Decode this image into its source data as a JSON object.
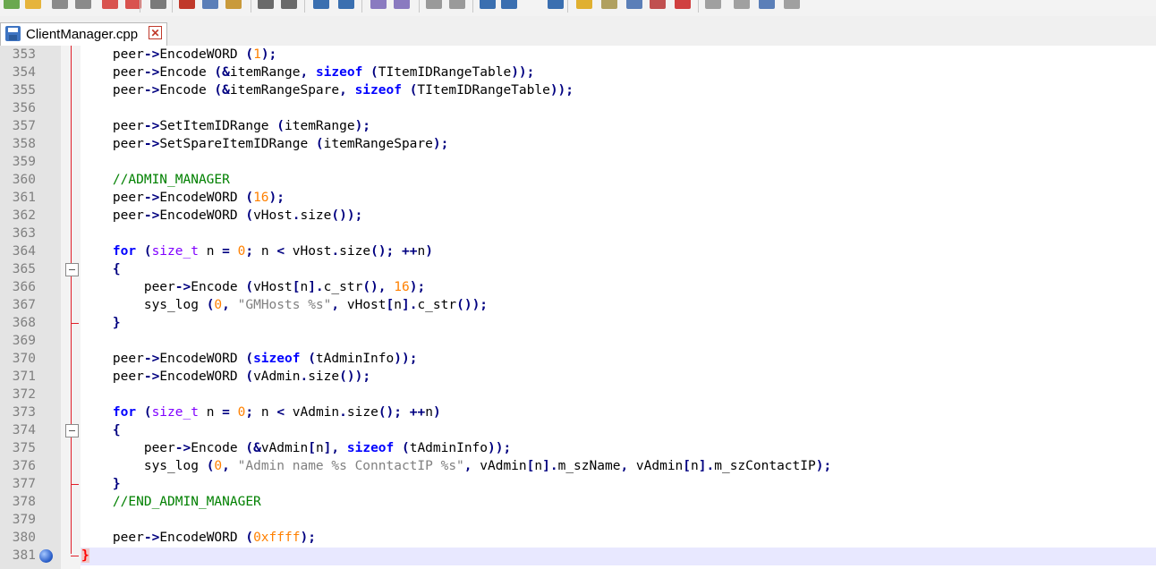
{
  "toolbar": {
    "icons": [
      "new-file",
      "open-file",
      "save",
      "save-all",
      "close",
      "close-all",
      "print",
      "cut",
      "copy",
      "paste",
      "undo",
      "redo",
      "find",
      "replace",
      "zoom-in",
      "zoom-out",
      "sync-v",
      "sync-h",
      "word-wrap",
      "show-all",
      "indent-guide",
      "folder",
      "document-map",
      "function-list",
      "monitor",
      "record-macro",
      "stop-record",
      "play-macro",
      "run-macro-multiple",
      "save-macro"
    ]
  },
  "tab": {
    "filename": "ClientManager.cpp",
    "close_glyph": "✕"
  },
  "editor": {
    "lines": [
      {
        "n": "353",
        "tokens": [
          [
            "ws",
            "    "
          ],
          [
            "ident",
            "peer"
          ],
          [
            "op",
            "->"
          ],
          [
            "ident",
            "EncodeWORD "
          ],
          [
            "op",
            "("
          ],
          [
            "num",
            "1"
          ],
          [
            "op",
            ");"
          ]
        ]
      },
      {
        "n": "354",
        "tokens": [
          [
            "ws",
            "    "
          ],
          [
            "ident",
            "peer"
          ],
          [
            "op",
            "->"
          ],
          [
            "ident",
            "Encode "
          ],
          [
            "op",
            "(&"
          ],
          [
            "ident",
            "itemRange"
          ],
          [
            "op",
            ", "
          ],
          [
            "kw",
            "sizeof "
          ],
          [
            "op",
            "("
          ],
          [
            "ident",
            "TItemIDRangeTable"
          ],
          [
            "op",
            "));"
          ]
        ]
      },
      {
        "n": "355",
        "tokens": [
          [
            "ws",
            "    "
          ],
          [
            "ident",
            "peer"
          ],
          [
            "op",
            "->"
          ],
          [
            "ident",
            "Encode "
          ],
          [
            "op",
            "(&"
          ],
          [
            "ident",
            "itemRangeSpare"
          ],
          [
            "op",
            ", "
          ],
          [
            "kw",
            "sizeof "
          ],
          [
            "op",
            "("
          ],
          [
            "ident",
            "TItemIDRangeTable"
          ],
          [
            "op",
            "));"
          ]
        ]
      },
      {
        "n": "356",
        "tokens": []
      },
      {
        "n": "357",
        "tokens": [
          [
            "ws",
            "    "
          ],
          [
            "ident",
            "peer"
          ],
          [
            "op",
            "->"
          ],
          [
            "ident",
            "SetItemIDRange "
          ],
          [
            "op",
            "("
          ],
          [
            "ident",
            "itemRange"
          ],
          [
            "op",
            ");"
          ]
        ]
      },
      {
        "n": "358",
        "tokens": [
          [
            "ws",
            "    "
          ],
          [
            "ident",
            "peer"
          ],
          [
            "op",
            "->"
          ],
          [
            "ident",
            "SetSpareItemIDRange "
          ],
          [
            "op",
            "("
          ],
          [
            "ident",
            "itemRangeSpare"
          ],
          [
            "op",
            ");"
          ]
        ]
      },
      {
        "n": "359",
        "tokens": []
      },
      {
        "n": "360",
        "tokens": [
          [
            "ws",
            "    "
          ],
          [
            "cmt",
            "//ADMIN_MANAGER"
          ]
        ]
      },
      {
        "n": "361",
        "tokens": [
          [
            "ws",
            "    "
          ],
          [
            "ident",
            "peer"
          ],
          [
            "op",
            "->"
          ],
          [
            "ident",
            "EncodeWORD "
          ],
          [
            "op",
            "("
          ],
          [
            "num",
            "16"
          ],
          [
            "op",
            ");"
          ]
        ]
      },
      {
        "n": "362",
        "tokens": [
          [
            "ws",
            "    "
          ],
          [
            "ident",
            "peer"
          ],
          [
            "op",
            "->"
          ],
          [
            "ident",
            "EncodeWORD "
          ],
          [
            "op",
            "("
          ],
          [
            "ident",
            "vHost"
          ],
          [
            "op",
            "."
          ],
          [
            "ident",
            "size"
          ],
          [
            "op",
            "());"
          ]
        ]
      },
      {
        "n": "363",
        "tokens": []
      },
      {
        "n": "364",
        "tokens": [
          [
            "ws",
            "    "
          ],
          [
            "kw",
            "for "
          ],
          [
            "op",
            "("
          ],
          [
            "type",
            "size_t"
          ],
          [
            "ident",
            " n "
          ],
          [
            "op",
            "= "
          ],
          [
            "num",
            "0"
          ],
          [
            "op",
            "; "
          ],
          [
            "ident",
            "n "
          ],
          [
            "op",
            "< "
          ],
          [
            "ident",
            "vHost"
          ],
          [
            "op",
            "."
          ],
          [
            "ident",
            "size"
          ],
          [
            "op",
            "(); ++"
          ],
          [
            "ident",
            "n"
          ],
          [
            "op",
            ")"
          ]
        ]
      },
      {
        "n": "365",
        "tokens": [
          [
            "ws",
            "    "
          ],
          [
            "op",
            "{"
          ]
        ]
      },
      {
        "n": "366",
        "tokens": [
          [
            "ws",
            "        "
          ],
          [
            "ident",
            "peer"
          ],
          [
            "op",
            "->"
          ],
          [
            "ident",
            "Encode "
          ],
          [
            "op",
            "("
          ],
          [
            "ident",
            "vHost"
          ],
          [
            "op",
            "["
          ],
          [
            "ident",
            "n"
          ],
          [
            "op",
            "]."
          ],
          [
            "ident",
            "c_str"
          ],
          [
            "op",
            "(), "
          ],
          [
            "num",
            "16"
          ],
          [
            "op",
            ");"
          ]
        ]
      },
      {
        "n": "367",
        "tokens": [
          [
            "ws",
            "        "
          ],
          [
            "ident",
            "sys_log "
          ],
          [
            "op",
            "("
          ],
          [
            "num",
            "0"
          ],
          [
            "op",
            ", "
          ],
          [
            "str",
            "\"GMHosts %s\""
          ],
          [
            "op",
            ", "
          ],
          [
            "ident",
            "vHost"
          ],
          [
            "op",
            "["
          ],
          [
            "ident",
            "n"
          ],
          [
            "op",
            "]."
          ],
          [
            "ident",
            "c_str"
          ],
          [
            "op",
            "());"
          ]
        ]
      },
      {
        "n": "368",
        "tokens": [
          [
            "ws",
            "    "
          ],
          [
            "op",
            "}"
          ]
        ]
      },
      {
        "n": "369",
        "tokens": []
      },
      {
        "n": "370",
        "tokens": [
          [
            "ws",
            "    "
          ],
          [
            "ident",
            "peer"
          ],
          [
            "op",
            "->"
          ],
          [
            "ident",
            "EncodeWORD "
          ],
          [
            "op",
            "("
          ],
          [
            "kw",
            "sizeof "
          ],
          [
            "op",
            "("
          ],
          [
            "ident",
            "tAdminInfo"
          ],
          [
            "op",
            "));"
          ]
        ]
      },
      {
        "n": "371",
        "tokens": [
          [
            "ws",
            "    "
          ],
          [
            "ident",
            "peer"
          ],
          [
            "op",
            "->"
          ],
          [
            "ident",
            "EncodeWORD "
          ],
          [
            "op",
            "("
          ],
          [
            "ident",
            "vAdmin"
          ],
          [
            "op",
            "."
          ],
          [
            "ident",
            "size"
          ],
          [
            "op",
            "());"
          ]
        ]
      },
      {
        "n": "372",
        "tokens": []
      },
      {
        "n": "373",
        "tokens": [
          [
            "ws",
            "    "
          ],
          [
            "kw",
            "for "
          ],
          [
            "op",
            "("
          ],
          [
            "type",
            "size_t"
          ],
          [
            "ident",
            " n "
          ],
          [
            "op",
            "= "
          ],
          [
            "num",
            "0"
          ],
          [
            "op",
            "; "
          ],
          [
            "ident",
            "n "
          ],
          [
            "op",
            "< "
          ],
          [
            "ident",
            "vAdmin"
          ],
          [
            "op",
            "."
          ],
          [
            "ident",
            "size"
          ],
          [
            "op",
            "(); ++"
          ],
          [
            "ident",
            "n"
          ],
          [
            "op",
            ")"
          ]
        ]
      },
      {
        "n": "374",
        "tokens": [
          [
            "ws",
            "    "
          ],
          [
            "op",
            "{"
          ]
        ]
      },
      {
        "n": "375",
        "tokens": [
          [
            "ws",
            "        "
          ],
          [
            "ident",
            "peer"
          ],
          [
            "op",
            "->"
          ],
          [
            "ident",
            "Encode "
          ],
          [
            "op",
            "(&"
          ],
          [
            "ident",
            "vAdmin"
          ],
          [
            "op",
            "["
          ],
          [
            "ident",
            "n"
          ],
          [
            "op",
            "], "
          ],
          [
            "kw",
            "sizeof "
          ],
          [
            "op",
            "("
          ],
          [
            "ident",
            "tAdminInfo"
          ],
          [
            "op",
            "));"
          ]
        ]
      },
      {
        "n": "376",
        "tokens": [
          [
            "ws",
            "        "
          ],
          [
            "ident",
            "sys_log "
          ],
          [
            "op",
            "("
          ],
          [
            "num",
            "0"
          ],
          [
            "op",
            ", "
          ],
          [
            "str",
            "\"Admin name %s ConntactIP %s\""
          ],
          [
            "op",
            ", "
          ],
          [
            "ident",
            "vAdmin"
          ],
          [
            "op",
            "["
          ],
          [
            "ident",
            "n"
          ],
          [
            "op",
            "]."
          ],
          [
            "ident",
            "m_szName"
          ],
          [
            "op",
            ", "
          ],
          [
            "ident",
            "vAdmin"
          ],
          [
            "op",
            "["
          ],
          [
            "ident",
            "n"
          ],
          [
            "op",
            "]."
          ],
          [
            "ident",
            "m_szContactIP"
          ],
          [
            "op",
            ");"
          ]
        ]
      },
      {
        "n": "377",
        "tokens": [
          [
            "ws",
            "    "
          ],
          [
            "op",
            "}"
          ]
        ]
      },
      {
        "n": "378",
        "tokens": [
          [
            "ws",
            "    "
          ],
          [
            "cmt",
            "//END_ADMIN_MANAGER"
          ]
        ]
      },
      {
        "n": "379",
        "tokens": []
      },
      {
        "n": "380",
        "tokens": [
          [
            "ws",
            "    "
          ],
          [
            "ident",
            "peer"
          ],
          [
            "op",
            "->"
          ],
          [
            "ident",
            "EncodeWORD "
          ],
          [
            "op",
            "("
          ],
          [
            "num",
            "0xffff"
          ],
          [
            "op",
            ");"
          ]
        ]
      },
      {
        "n": "381",
        "tokens": [
          [
            "brace-err",
            "}"
          ]
        ]
      }
    ],
    "fold_markers": [
      "365",
      "374"
    ],
    "bookmark_line": "381",
    "current_line": "381"
  }
}
